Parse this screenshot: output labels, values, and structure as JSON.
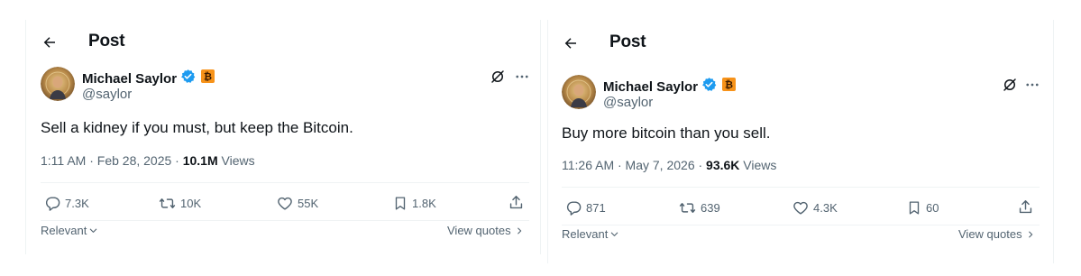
{
  "posts": [
    {
      "header_title": "Post",
      "author_name": "Michael Saylor",
      "handle": "@saylor",
      "text": "Sell a kidney if you must, but keep the Bitcoin.",
      "time": "1:11 AM · Feb 28, 2025 · ",
      "views_count": "10.1M",
      "views_label": " Views",
      "replies": "7.3K",
      "reposts": "10K",
      "likes": "55K",
      "bookmarks": "1.8K",
      "sort_label": "Relevant",
      "view_quotes": "View quotes"
    },
    {
      "header_title": "Post",
      "author_name": "Michael Saylor",
      "handle": "@saylor",
      "text": "Buy more bitcoin than you sell.",
      "time": "11:26 AM · May 7, 2026 · ",
      "views_count": "93.6K",
      "views_label": " Views",
      "replies": "871",
      "reposts": "639",
      "likes": "4.3K",
      "bookmarks": "60",
      "sort_label": "Relevant",
      "view_quotes": "View quotes"
    }
  ],
  "colors": {
    "verified": "#1d9bf0",
    "affiliate_badge": "#f7931a",
    "text": "#0f1419",
    "secondary": "#536471",
    "divider": "#eff3f4"
  },
  "icons": [
    "back-arrow-icon",
    "verified-badge-icon",
    "bitcoin-badge-icon",
    "grok-icon",
    "more-icon",
    "reply-icon",
    "repost-icon",
    "like-icon",
    "bookmark-icon",
    "share-icon",
    "chevron-down-icon",
    "chevron-right-icon"
  ]
}
